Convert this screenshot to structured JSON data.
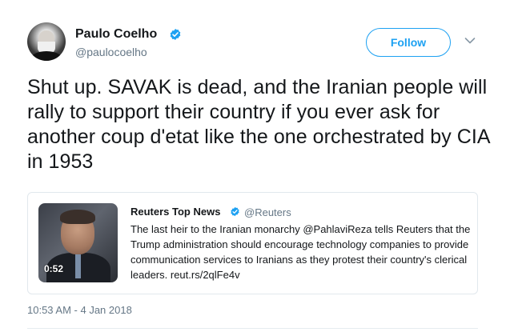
{
  "author": {
    "display_name": "Paulo Coelho",
    "handle": "@paulocoelho",
    "verified_icon": "verified-badge-icon"
  },
  "header": {
    "follow_label": "Follow",
    "menu_icon": "chevron-down-icon"
  },
  "tweet": {
    "text": "Shut up. SAVAK is dead, and the Iranian people will rally to support their country if you ever ask for another coup d'etat like the one orchestrated by CIA in 1953",
    "timestamp": "10:53 AM - 4 Jan 2018"
  },
  "quoted_tweet": {
    "display_name": "Reuters Top News",
    "handle": "@Reuters",
    "text": "The last heir to the Iranian monarchy @PahlaviReza tells Reuters that the Trump administration should encourage technology companies to provide communication services to Iranians as they protest their country's clerical leaders. reut.rs/2qlFe4v",
    "media_duration": "0:52"
  },
  "colors": {
    "accent": "#1da1f2",
    "text": "#14171a",
    "muted": "#657786",
    "border": "#e1e8ed"
  }
}
